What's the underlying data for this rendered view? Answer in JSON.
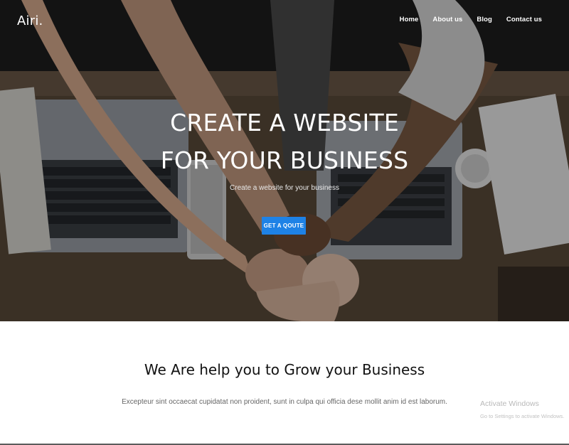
{
  "brand": {
    "logo": "Airi."
  },
  "nav": {
    "items": [
      {
        "label": "Home"
      },
      {
        "label": "About us"
      },
      {
        "label": "Blog"
      },
      {
        "label": "Contact us"
      }
    ]
  },
  "hero": {
    "title_line1": "CREATE A WEBSITE",
    "title_line2": "FOR YOUR BUSINESS",
    "subtitle": "Create a website for your business",
    "cta_label": "GET A QOUTE"
  },
  "section": {
    "title": "We Are help you to Grow your Business",
    "text": "Excepteur sint occaecat cupidatat non proident, sunt in culpa qui officia dese mollit anim id est laborum."
  },
  "watermark": {
    "title": "Activate Windows",
    "subtitle": "Go to Settings to activate Windows."
  },
  "colors": {
    "accent": "#1e82e6",
    "hero_overlay": "#000000"
  }
}
